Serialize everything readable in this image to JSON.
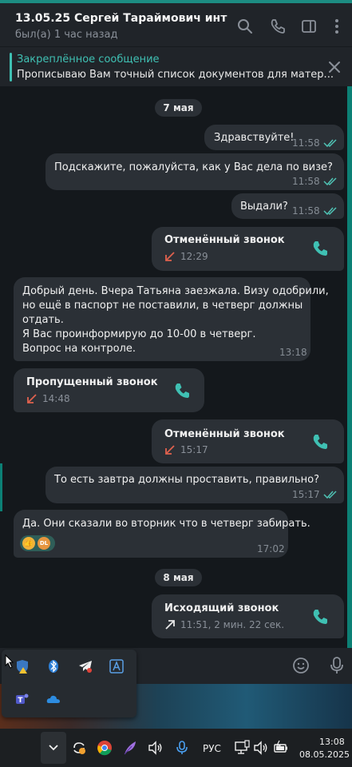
{
  "header": {
    "title": "13.05.25 Сергей Тараймович инт",
    "status": "был(а) 1 час назад",
    "icons": [
      "search-icon",
      "phone-icon",
      "sidebar-icon",
      "more-icon"
    ]
  },
  "pinned": {
    "title": "Закреплённое сообщение",
    "text": "Прописываю Вам точный список документов для матер..."
  },
  "chat": {
    "date1": "7 мая",
    "m1": {
      "text": "Здравствуйте!",
      "time": "11:58"
    },
    "m2": {
      "text": "Подскажите, пожалуйста, как у Вас дела по визе?",
      "time": "11:58"
    },
    "m3": {
      "text": "Выдали?",
      "time": "11:58"
    },
    "c1": {
      "title": "Отменённый звонок",
      "time": "12:29"
    },
    "m4": {
      "line1": "Добрый день. Вчера Татьяна заезжала. Визу одобрили,",
      "line2": "но ещё в паспорт не поставили, в четверг должны",
      "line3": "отдать.",
      "line4": "Я Вас проинформирую до 10-00 в четверг.",
      "line5": "Вопрос на контроле.",
      "time": "13:18"
    },
    "c2": {
      "title": "Пропущенный звонок",
      "time": "14:48"
    },
    "c3": {
      "title": "Отменённый звонок",
      "time": "15:17"
    },
    "m5": {
      "text": "То есть завтра должны проставить, правильно?",
      "time": "15:17"
    },
    "m6": {
      "text": "Да. Они сказали во вторник что в четверг забирать.",
      "time": "17:02",
      "reaction_label": "DL"
    },
    "date2": "8 мая",
    "c4": {
      "title": "Исходящий звонок",
      "detail": "11:51, 2 мин. 22 сек."
    }
  },
  "taskbar": {
    "lang": "РУС",
    "time": "13:08",
    "date": "08.05.2025"
  },
  "colors": {
    "accent": "#3fc0b3",
    "bubble": "#2b3036",
    "call_missed": "#e0614e",
    "ticks": "#4fc3b5"
  }
}
